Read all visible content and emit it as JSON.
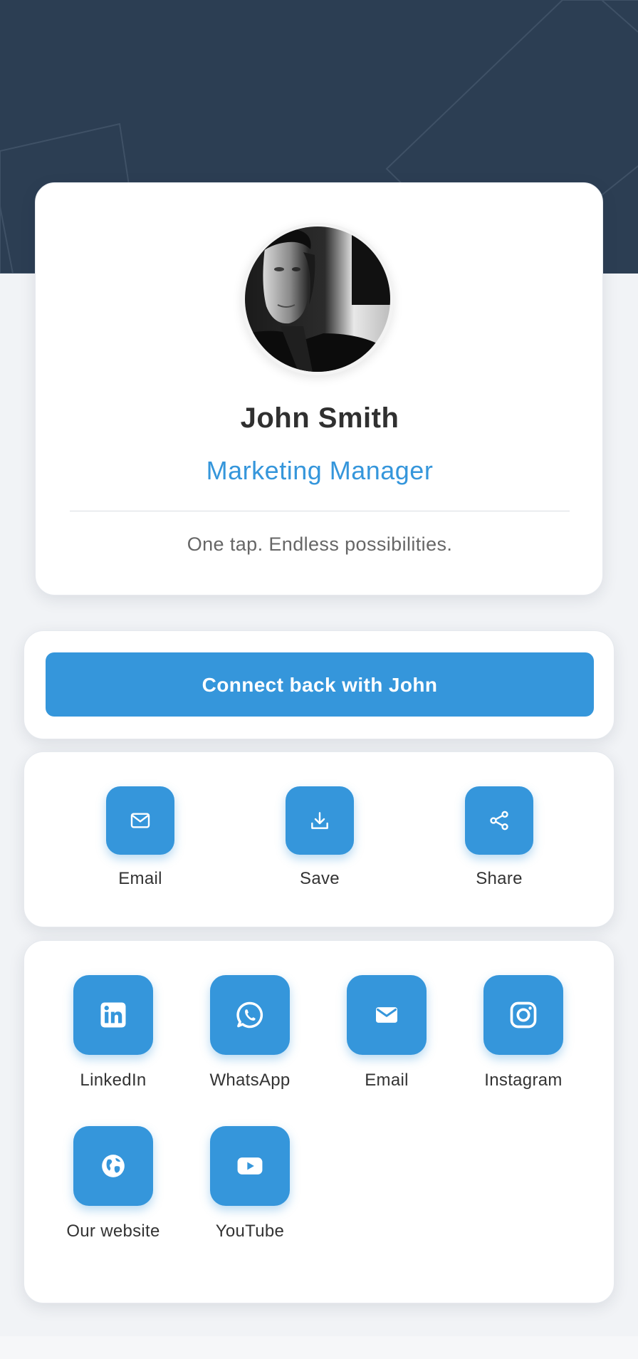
{
  "profile": {
    "name": "John Smith",
    "title": "Marketing Manager",
    "tagline": "One tap. Endless possibilities."
  },
  "connect": {
    "button_label": "Connect back with John"
  },
  "actions": [
    {
      "label": "Email",
      "icon": "mail-outline-icon"
    },
    {
      "label": "Save",
      "icon": "download-icon"
    },
    {
      "label": "Share",
      "icon": "share-icon"
    }
  ],
  "links": [
    {
      "label": "LinkedIn",
      "icon": "linkedin-icon"
    },
    {
      "label": "WhatsApp",
      "icon": "whatsapp-icon"
    },
    {
      "label": "Email",
      "icon": "email-icon"
    },
    {
      "label": "Instagram",
      "icon": "instagram-icon"
    },
    {
      "label": "Our website",
      "icon": "globe-icon"
    },
    {
      "label": "YouTube",
      "icon": "youtube-icon"
    }
  ],
  "colors": {
    "accent": "#3596db",
    "hero_background": "#2c3e53",
    "page_background": "#f1f3f6",
    "card_background": "#ffffff"
  }
}
